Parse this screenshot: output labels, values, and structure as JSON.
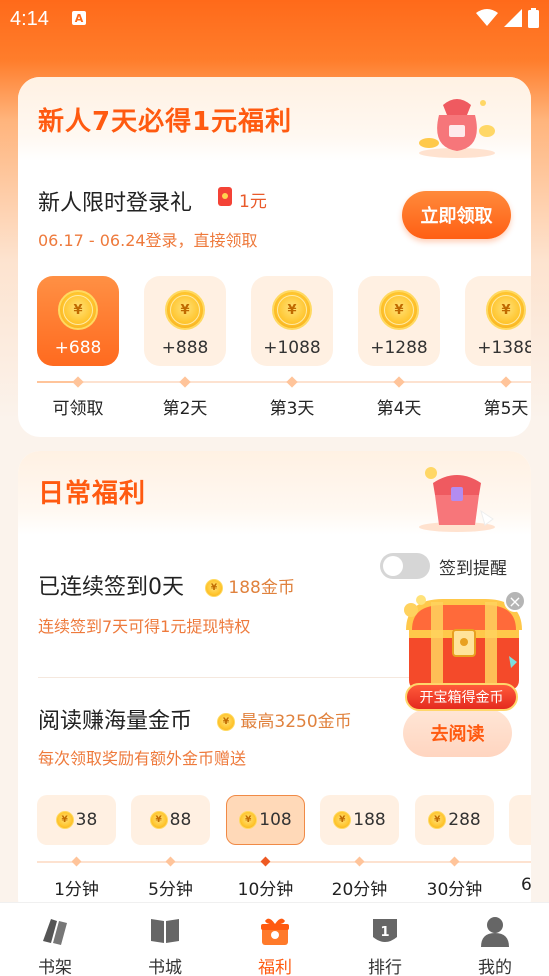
{
  "status_bar": {
    "time": "4:14",
    "notification_icon": "A"
  },
  "newbie_card": {
    "title": "新人7天必得1元福利",
    "login_gift_title": "新人限时登录礼",
    "login_gift_amount": "1元",
    "login_gift_desc": "06.17 - 06.24登录，直接领取",
    "claim_button": "立即领取",
    "days": [
      {
        "value": "+688",
        "label": "可领取",
        "active": true
      },
      {
        "value": "+888",
        "label": "第2天",
        "active": false
      },
      {
        "value": "+1088",
        "label": "第3天",
        "active": false
      },
      {
        "value": "+1288",
        "label": "第4天",
        "active": false
      },
      {
        "value": "+1388",
        "label": "第5天",
        "active": false
      }
    ],
    "coin_symbol": "¥"
  },
  "daily_card": {
    "title": "日常福利",
    "remind_label": "签到提醒",
    "remind_enabled": false,
    "checkin_title": "已连续签到0天",
    "checkin_reward": "188金币",
    "checkin_desc": "连续签到7天可得1元提现特权",
    "read_title": "阅读赚海量金币",
    "read_reward": "最高3250金币",
    "read_desc": "每次领取奖励有额外金币赠送",
    "read_button": "去阅读",
    "times": [
      {
        "value": "38",
        "label": "1分钟",
        "active": false
      },
      {
        "value": "88",
        "label": "5分钟",
        "active": false
      },
      {
        "value": "108",
        "label": "10分钟",
        "active": true
      },
      {
        "value": "188",
        "label": "20分钟",
        "active": false
      },
      {
        "value": "288",
        "label": "30分钟",
        "active": false
      },
      {
        "value": "",
        "label": "6",
        "active": false
      }
    ]
  },
  "treasure": {
    "label": "开宝箱得金币",
    "close_glyph": "×"
  },
  "nav": [
    {
      "label": "书架",
      "icon": "bookshelf-icon",
      "active": false
    },
    {
      "label": "书城",
      "icon": "bookstore-icon",
      "active": false
    },
    {
      "label": "福利",
      "icon": "gift-icon",
      "active": true
    },
    {
      "label": "排行",
      "icon": "ranking-icon",
      "active": false
    },
    {
      "label": "我的",
      "icon": "profile-icon",
      "active": false
    }
  ],
  "colors": {
    "brand": "#ff5a10",
    "header_orange": "#ff6a1a",
    "accent_text": "#ee7a3c",
    "inactive_tile": "#fff0e2"
  }
}
